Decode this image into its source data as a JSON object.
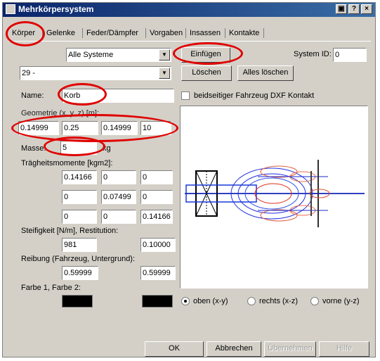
{
  "window": {
    "title": "Mehrkörpersystem"
  },
  "tabs": [
    {
      "label": "Körper"
    },
    {
      "label": "Gelenke"
    },
    {
      "label": "Feder/Dämpfer"
    },
    {
      "label": "Vorgaben"
    },
    {
      "label": "Insassen"
    },
    {
      "label": "Kontakte"
    }
  ],
  "system_filter": {
    "selected": "Alle Systeme"
  },
  "body_select": {
    "selected": "29 -"
  },
  "buttons": {
    "insert": "Einfügen",
    "delete": "Löschen",
    "delete_all": "Alles löschen",
    "ok": "OK",
    "cancel": "Abbrechen",
    "apply": "Übernehmen",
    "help": "Hilfe"
  },
  "system_id": {
    "label": "System ID:",
    "value": "0"
  },
  "name": {
    "label": "Name:",
    "value": "Korb"
  },
  "dxf_contact": {
    "label": "beidseitiger Fahrzeug DXF Kontakt"
  },
  "geometry": {
    "label": "Geometrie (x, y, z) [m]:",
    "values": [
      "0.14999",
      "0.25",
      "0.14999",
      "10"
    ]
  },
  "mass": {
    "label": "Masse:",
    "value": "5",
    "unit": "kg"
  },
  "inertia": {
    "label": "Trägheitsmomente [kgm2]:",
    "rows": [
      [
        "0.14166",
        "0",
        "0"
      ],
      [
        "0",
        "0.07499",
        "0"
      ],
      [
        "0",
        "0",
        "0.14166"
      ]
    ]
  },
  "stiffness": {
    "label": "Steifigkeit [N/m], Restitution:",
    "stiffness": "981",
    "restitution": "0.10000"
  },
  "friction": {
    "label": "Reibung (Fahrzeug, Untergrund):",
    "vehicle": "0.59999",
    "ground": "0.59999"
  },
  "colors": {
    "label": "Farbe 1, Farbe 2:",
    "color1": "#000000",
    "color2": "#000000"
  },
  "view": {
    "options": [
      "oben (x-y)",
      "rechts (x-z)",
      "vorne (y-z)"
    ],
    "selected": "oben (x-y)"
  },
  "icons": [
    "app-icon",
    "window-icon",
    "help-icon",
    "close-icon",
    "dropdown-arrow-icon"
  ]
}
